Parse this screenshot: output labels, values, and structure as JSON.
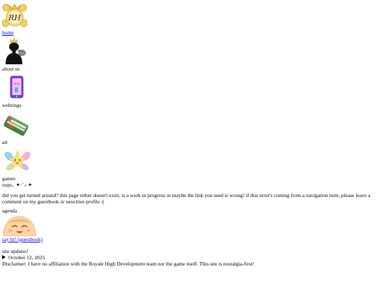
{
  "nav": {
    "home": {
      "label": "home",
      "icon": "crown-monogram-logo"
    },
    "about": {
      "label": "about us",
      "icon": "king-silhouette-icon"
    },
    "webrings": {
      "label": "webrings",
      "icon": "purple-phone-icon"
    },
    "art": {
      "label": "art",
      "icon": "book-icon"
    },
    "games": {
      "label": "games",
      "icon": "fairy-star-icon"
    }
  },
  "logo_monogram": "RH",
  "error": {
    "title": "oops.. ✦·˚₊ ✦",
    "message": "did you get turned around? this page either doesn't exist, is a work in progress or maybe the link you used is wrong! if this error's coming from a navigation item, please leave a comment on my guestbook or neocities profile :("
  },
  "agenda": {
    "label": "agenda",
    "guestbook_link": "say hi! (guestbook)",
    "guestbook_icon": "smiling-face-icon"
  },
  "updates": {
    "heading": "site updates!",
    "latest_date": "October 12, 2025"
  },
  "disclaimer": "Disclaimer: I have no affiliation with the Royale High Development team nor the game itself. This site is nostalgia-first!",
  "colors": {
    "link": "#0000ee",
    "gold": "#e8c14a",
    "purple": "#7b3fd6",
    "pink": "#ff8fc8",
    "green": "#3e8a3a"
  }
}
